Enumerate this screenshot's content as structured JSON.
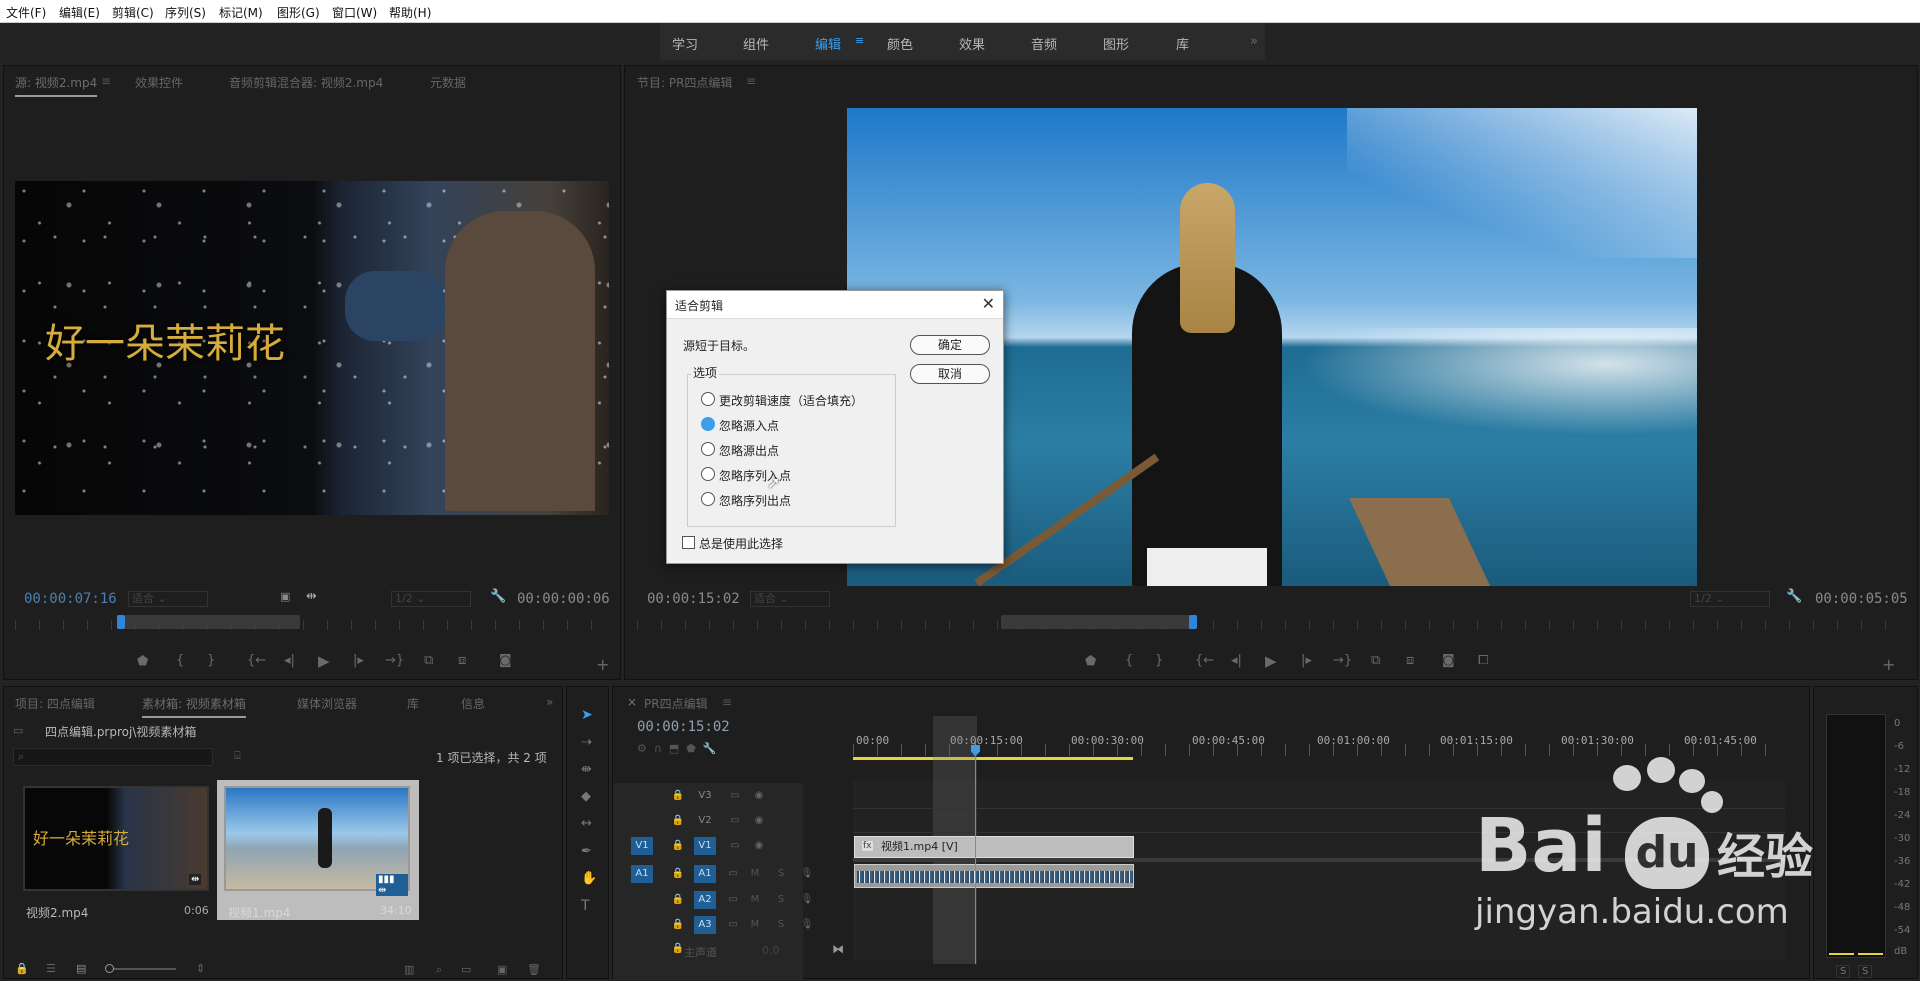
{
  "menu": [
    "文件(F)",
    "编辑(E)",
    "剪辑(C)",
    "序列(S)",
    "标记(M)",
    "图形(G)",
    "窗口(W)",
    "帮助(H)"
  ],
  "workspaces": [
    {
      "label": "学习",
      "active": false
    },
    {
      "label": "组件",
      "active": false
    },
    {
      "label": "编辑",
      "active": true
    },
    {
      "label": "颜色",
      "active": false
    },
    {
      "label": "效果",
      "active": false
    },
    {
      "label": "音频",
      "active": false
    },
    {
      "label": "图形",
      "active": false
    },
    {
      "label": "库",
      "active": false
    }
  ],
  "source": {
    "tabs": [
      "源: 视频2.mp4",
      "效果控件",
      "音频剪辑混合器: 视频2.mp4",
      "元数据"
    ],
    "title_overlay": "好一朵茉莉花",
    "timecode": "00:00:07:16",
    "fit": "适合",
    "scale": "1/2",
    "duration": "00:00:00:06"
  },
  "program": {
    "tab": "节目: PR四点编辑",
    "timecode": "00:00:15:02",
    "fit": "适合",
    "scale": "1/2",
    "duration": "00:00:05:05"
  },
  "dialog": {
    "title": "适合剪辑",
    "message": "源短于目标。",
    "ok": "确定",
    "cancel": "取消",
    "group_label": "选项",
    "options": [
      {
        "label": "更改剪辑速度（适合填充）",
        "selected": false
      },
      {
        "label": "忽略源入点",
        "selected": true
      },
      {
        "label": "忽略源出点",
        "selected": false
      },
      {
        "label": "忽略序列入点",
        "selected": false
      },
      {
        "label": "忽略序列出点",
        "selected": false
      }
    ],
    "always_use": "总是使用此选择",
    "always_checked": false
  },
  "project": {
    "tabs": [
      "项目: 四点编辑",
      "素材箱: 视频素材箱",
      "媒体浏览器",
      "库",
      "信息"
    ],
    "path": "四点编辑.prproj\\视频素材箱",
    "selection_info": "1 项已选择，共 2 项",
    "items": [
      {
        "name": "视频2.mp4",
        "duration": "0:06",
        "overlay": "好一朵茉莉花",
        "selected": false
      },
      {
        "name": "视频1.mp4",
        "duration": "34:10",
        "selected": true
      }
    ]
  },
  "timeline": {
    "tab": "PR四点编辑",
    "timecode": "00:00:15:02",
    "ruler": [
      "00:00",
      "00:00:15:00",
      "00:00:30:00",
      "00:00:45:00",
      "00:01:00:00",
      "00:01:15:00",
      "00:01:30:00",
      "00:01:45:00"
    ],
    "video_tracks": [
      "V3",
      "V2",
      "V1"
    ],
    "audio_tracks": [
      "A1",
      "A2",
      "A3"
    ],
    "src_v": "V1",
    "src_a": "A1",
    "master": "主声道",
    "master_value": "0.0",
    "clip_v": "视频1.mp4 [V]",
    "m": "M",
    "s": "S"
  },
  "meter": {
    "labels": [
      "0",
      "-6",
      "-12",
      "-18",
      "-24",
      "-30",
      "-36",
      "-42",
      "-48",
      "-54",
      "dB"
    ],
    "s_labels": [
      "S",
      "S"
    ]
  },
  "watermark": {
    "brand1": "Bai",
    "brand2": "du",
    "brand3": "经验",
    "url": "jingyan.baidu.com"
  },
  "colors": {
    "accent": "#3d9de9",
    "playhead": "#3d9de9",
    "work_area": "#e5d43b"
  }
}
